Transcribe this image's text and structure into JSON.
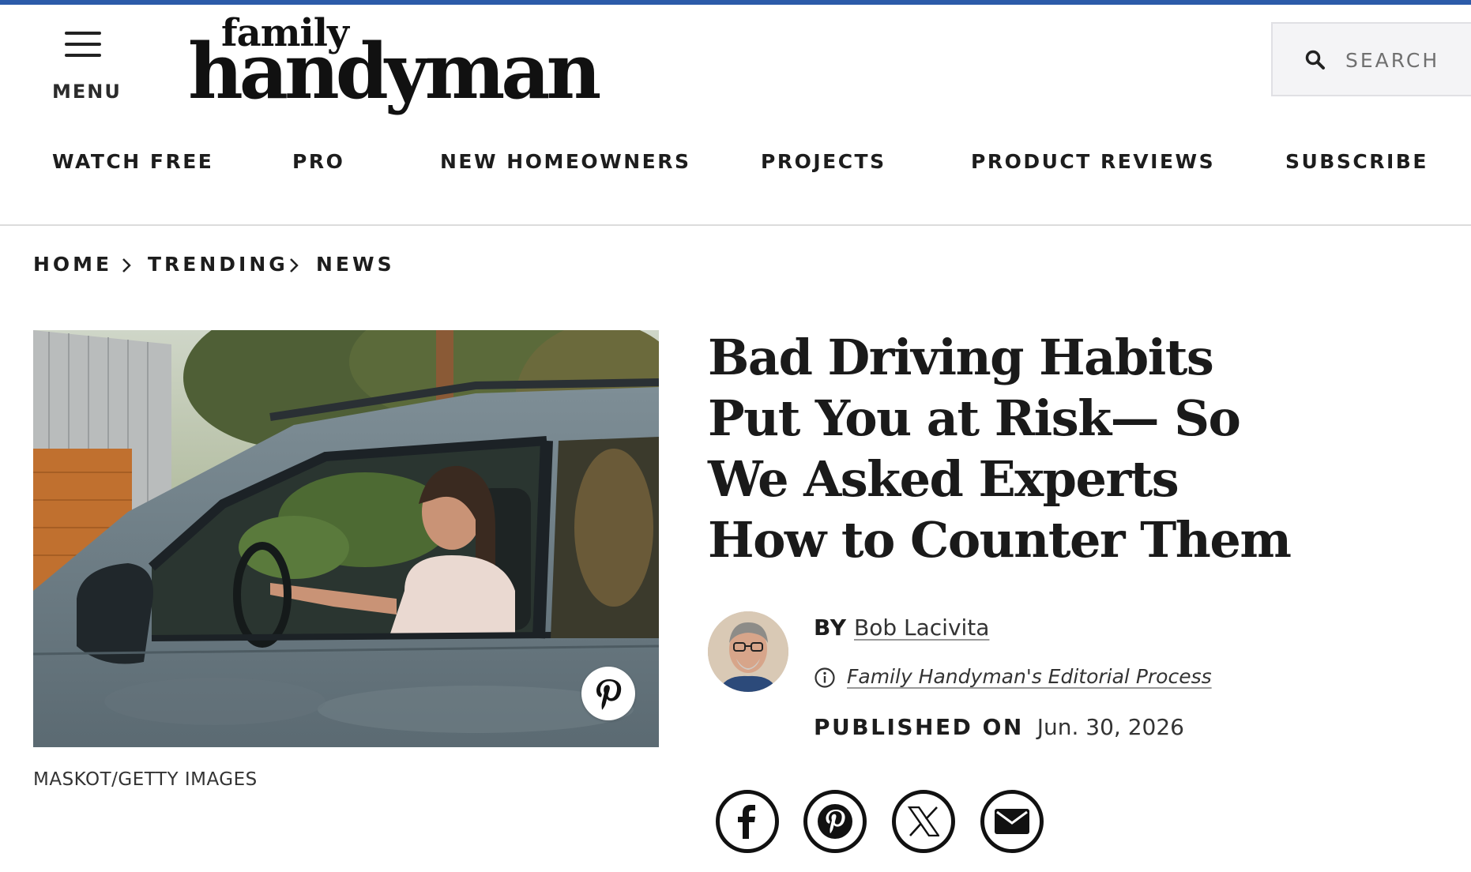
{
  "header": {
    "menu_label": "MENU",
    "logo_top": "family",
    "logo_main": "handyman",
    "search_placeholder": "SEARCH"
  },
  "nav": {
    "items": [
      {
        "label": "WATCH FREE"
      },
      {
        "label": "PRO"
      },
      {
        "label": "NEW HOMEOWNERS"
      },
      {
        "label": "PROJECTS"
      },
      {
        "label": "PRODUCT REVIEWS"
      },
      {
        "label": "SUBSCRIBE"
      }
    ]
  },
  "breadcrumb": {
    "items": [
      {
        "label": "HOME"
      },
      {
        "label": "TRENDING"
      },
      {
        "label": "NEWS"
      }
    ]
  },
  "article": {
    "image_credit": "MASKOT/GETTY IMAGES",
    "title": "Bad Driving Habits Put You at Risk— So We Asked Experts How to Counter Them",
    "by_label": "BY",
    "author": "Bob Lacivita",
    "editorial_process": "Family Handyman's Editorial Process",
    "published_label": "PUBLISHED ON",
    "published_date": "Jun. 30, 2026"
  },
  "share": {
    "icons": [
      "facebook-icon",
      "pinterest-icon",
      "x-icon",
      "email-icon"
    ]
  },
  "colors": {
    "top_bar": "#2c5ba9",
    "text": "#1a1a1a"
  }
}
